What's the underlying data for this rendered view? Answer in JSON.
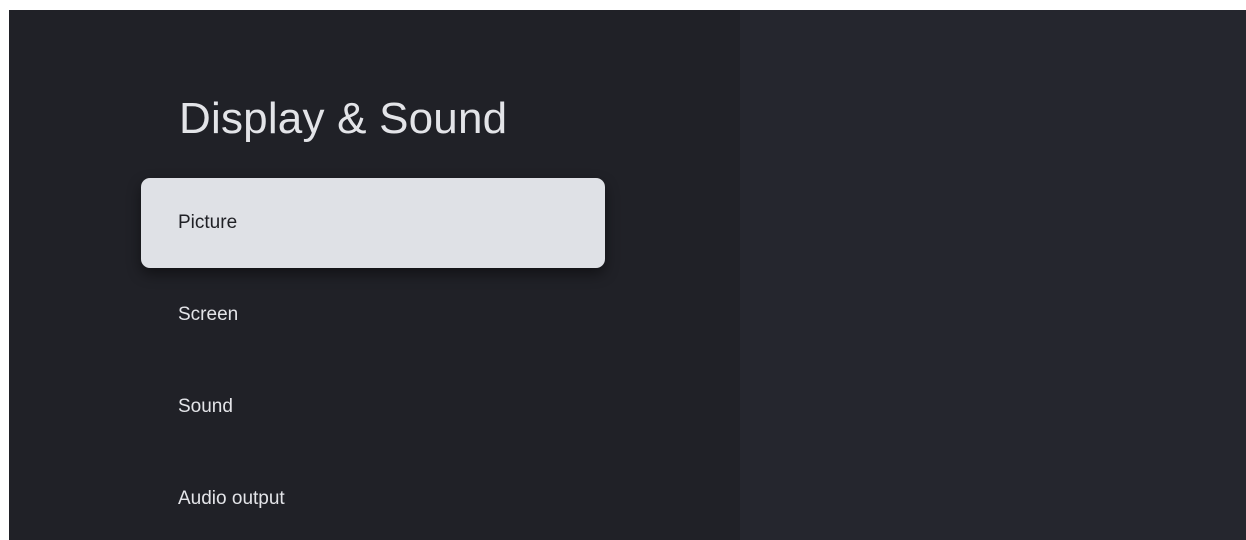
{
  "page": {
    "title": "Display & Sound"
  },
  "menu": {
    "items": [
      {
        "label": "Picture",
        "focused": true
      },
      {
        "label": "Screen",
        "focused": false
      },
      {
        "label": "Sound",
        "focused": false
      },
      {
        "label": "Audio output",
        "focused": false
      }
    ]
  },
  "colors": {
    "background": "#202127",
    "right_panel": "#25262e",
    "focused_item": "#dfe1e6",
    "text": "#e3e4e8"
  }
}
